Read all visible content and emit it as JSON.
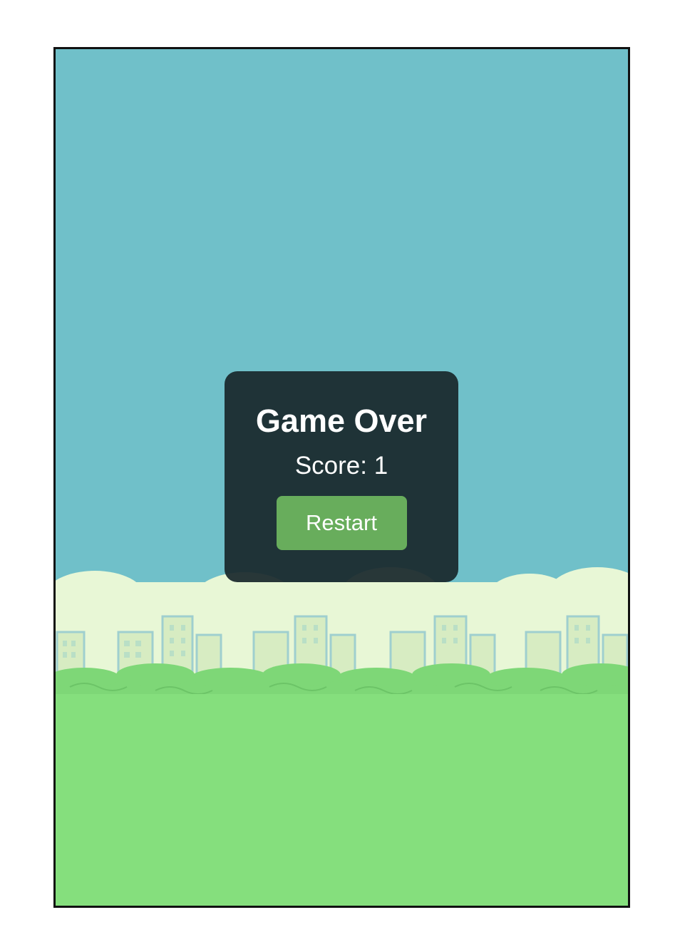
{
  "game": {
    "title": "Game Over",
    "score_text": "Score: 1",
    "restart_label": "Restart"
  },
  "colors": {
    "sky": "#70c0c9",
    "clouds": "#e8f7d6",
    "buildings": "#d7ecc2",
    "building_outline": "#9fcfcf",
    "bushes": "#7ed777",
    "ground": "#85df7d",
    "overlay": "#19282c",
    "button": "#68ad5c"
  }
}
